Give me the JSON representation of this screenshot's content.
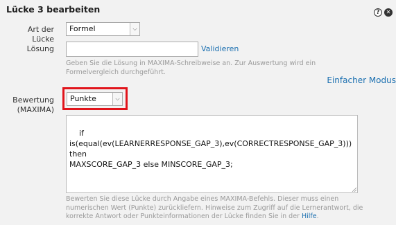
{
  "header": {
    "title": "Lücke 3 bearbeiten",
    "help_icon": "help-icon",
    "close_icon": "close-icon"
  },
  "gap_type": {
    "label": "Art der Lücke",
    "selected": "Formel"
  },
  "solution": {
    "label": "Lösung",
    "value": "",
    "validate_label": "Validieren",
    "hint": "Geben Sie die Lösung in MAXIMA-Schreibweise an. Zur Auswertung wird ein Formelvergleich durchgeführt."
  },
  "mode_link": "Einfacher Modus",
  "scoring": {
    "label_line1": "Bewertung",
    "label_line2": "(MAXIMA)",
    "selected": "Punkte",
    "expression": "if is(equal(ev(LEARNERRESPONSE_GAP_3),ev(CORRECTRESPONSE_GAP_3))) then\nMAXSCORE_GAP_3 else MINSCORE_GAP_3;",
    "hint": "Bewerten Sie diese Lücke durch Angabe eines MAXIMA-Befehls. Dieser muss einen numerischen Wert (Punkte) zurückliefern. Hinweise zum Zugriff auf die Lernerantwort, die korrekte Antwort oder Punkteinformationen der Lücke finden Sie in der",
    "hint_link": "Hilfe",
    "hint_end": "."
  },
  "colors": {
    "accent_link": "#1a6fb0",
    "highlight_border": "#e1141b"
  }
}
